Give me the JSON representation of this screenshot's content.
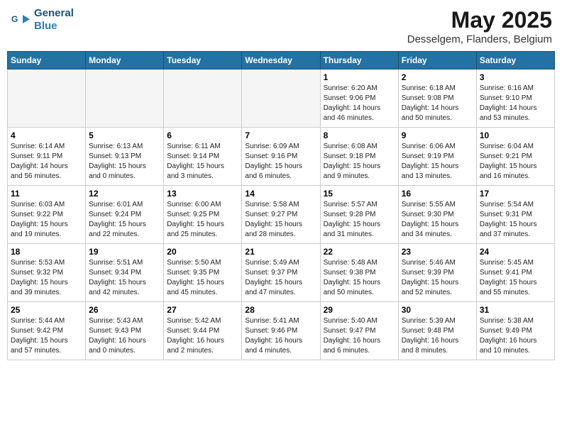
{
  "header": {
    "logo_line1": "General",
    "logo_line2": "Blue",
    "title": "May 2025",
    "subtitle": "Desselgem, Flanders, Belgium"
  },
  "weekdays": [
    "Sunday",
    "Monday",
    "Tuesday",
    "Wednesday",
    "Thursday",
    "Friday",
    "Saturday"
  ],
  "weeks": [
    [
      {
        "day": "",
        "info": ""
      },
      {
        "day": "",
        "info": ""
      },
      {
        "day": "",
        "info": ""
      },
      {
        "day": "",
        "info": ""
      },
      {
        "day": "1",
        "info": "Sunrise: 6:20 AM\nSunset: 9:06 PM\nDaylight: 14 hours\nand 46 minutes."
      },
      {
        "day": "2",
        "info": "Sunrise: 6:18 AM\nSunset: 9:08 PM\nDaylight: 14 hours\nand 50 minutes."
      },
      {
        "day": "3",
        "info": "Sunrise: 6:16 AM\nSunset: 9:10 PM\nDaylight: 14 hours\nand 53 minutes."
      }
    ],
    [
      {
        "day": "4",
        "info": "Sunrise: 6:14 AM\nSunset: 9:11 PM\nDaylight: 14 hours\nand 56 minutes."
      },
      {
        "day": "5",
        "info": "Sunrise: 6:13 AM\nSunset: 9:13 PM\nDaylight: 15 hours\nand 0 minutes."
      },
      {
        "day": "6",
        "info": "Sunrise: 6:11 AM\nSunset: 9:14 PM\nDaylight: 15 hours\nand 3 minutes."
      },
      {
        "day": "7",
        "info": "Sunrise: 6:09 AM\nSunset: 9:16 PM\nDaylight: 15 hours\nand 6 minutes."
      },
      {
        "day": "8",
        "info": "Sunrise: 6:08 AM\nSunset: 9:18 PM\nDaylight: 15 hours\nand 9 minutes."
      },
      {
        "day": "9",
        "info": "Sunrise: 6:06 AM\nSunset: 9:19 PM\nDaylight: 15 hours\nand 13 minutes."
      },
      {
        "day": "10",
        "info": "Sunrise: 6:04 AM\nSunset: 9:21 PM\nDaylight: 15 hours\nand 16 minutes."
      }
    ],
    [
      {
        "day": "11",
        "info": "Sunrise: 6:03 AM\nSunset: 9:22 PM\nDaylight: 15 hours\nand 19 minutes."
      },
      {
        "day": "12",
        "info": "Sunrise: 6:01 AM\nSunset: 9:24 PM\nDaylight: 15 hours\nand 22 minutes."
      },
      {
        "day": "13",
        "info": "Sunrise: 6:00 AM\nSunset: 9:25 PM\nDaylight: 15 hours\nand 25 minutes."
      },
      {
        "day": "14",
        "info": "Sunrise: 5:58 AM\nSunset: 9:27 PM\nDaylight: 15 hours\nand 28 minutes."
      },
      {
        "day": "15",
        "info": "Sunrise: 5:57 AM\nSunset: 9:28 PM\nDaylight: 15 hours\nand 31 minutes."
      },
      {
        "day": "16",
        "info": "Sunrise: 5:55 AM\nSunset: 9:30 PM\nDaylight: 15 hours\nand 34 minutes."
      },
      {
        "day": "17",
        "info": "Sunrise: 5:54 AM\nSunset: 9:31 PM\nDaylight: 15 hours\nand 37 minutes."
      }
    ],
    [
      {
        "day": "18",
        "info": "Sunrise: 5:53 AM\nSunset: 9:32 PM\nDaylight: 15 hours\nand 39 minutes."
      },
      {
        "day": "19",
        "info": "Sunrise: 5:51 AM\nSunset: 9:34 PM\nDaylight: 15 hours\nand 42 minutes."
      },
      {
        "day": "20",
        "info": "Sunrise: 5:50 AM\nSunset: 9:35 PM\nDaylight: 15 hours\nand 45 minutes."
      },
      {
        "day": "21",
        "info": "Sunrise: 5:49 AM\nSunset: 9:37 PM\nDaylight: 15 hours\nand 47 minutes."
      },
      {
        "day": "22",
        "info": "Sunrise: 5:48 AM\nSunset: 9:38 PM\nDaylight: 15 hours\nand 50 minutes."
      },
      {
        "day": "23",
        "info": "Sunrise: 5:46 AM\nSunset: 9:39 PM\nDaylight: 15 hours\nand 52 minutes."
      },
      {
        "day": "24",
        "info": "Sunrise: 5:45 AM\nSunset: 9:41 PM\nDaylight: 15 hours\nand 55 minutes."
      }
    ],
    [
      {
        "day": "25",
        "info": "Sunrise: 5:44 AM\nSunset: 9:42 PM\nDaylight: 15 hours\nand 57 minutes."
      },
      {
        "day": "26",
        "info": "Sunrise: 5:43 AM\nSunset: 9:43 PM\nDaylight: 16 hours\nand 0 minutes."
      },
      {
        "day": "27",
        "info": "Sunrise: 5:42 AM\nSunset: 9:44 PM\nDaylight: 16 hours\nand 2 minutes."
      },
      {
        "day": "28",
        "info": "Sunrise: 5:41 AM\nSunset: 9:46 PM\nDaylight: 16 hours\nand 4 minutes."
      },
      {
        "day": "29",
        "info": "Sunrise: 5:40 AM\nSunset: 9:47 PM\nDaylight: 16 hours\nand 6 minutes."
      },
      {
        "day": "30",
        "info": "Sunrise: 5:39 AM\nSunset: 9:48 PM\nDaylight: 16 hours\nand 8 minutes."
      },
      {
        "day": "31",
        "info": "Sunrise: 5:38 AM\nSunset: 9:49 PM\nDaylight: 16 hours\nand 10 minutes."
      }
    ]
  ]
}
